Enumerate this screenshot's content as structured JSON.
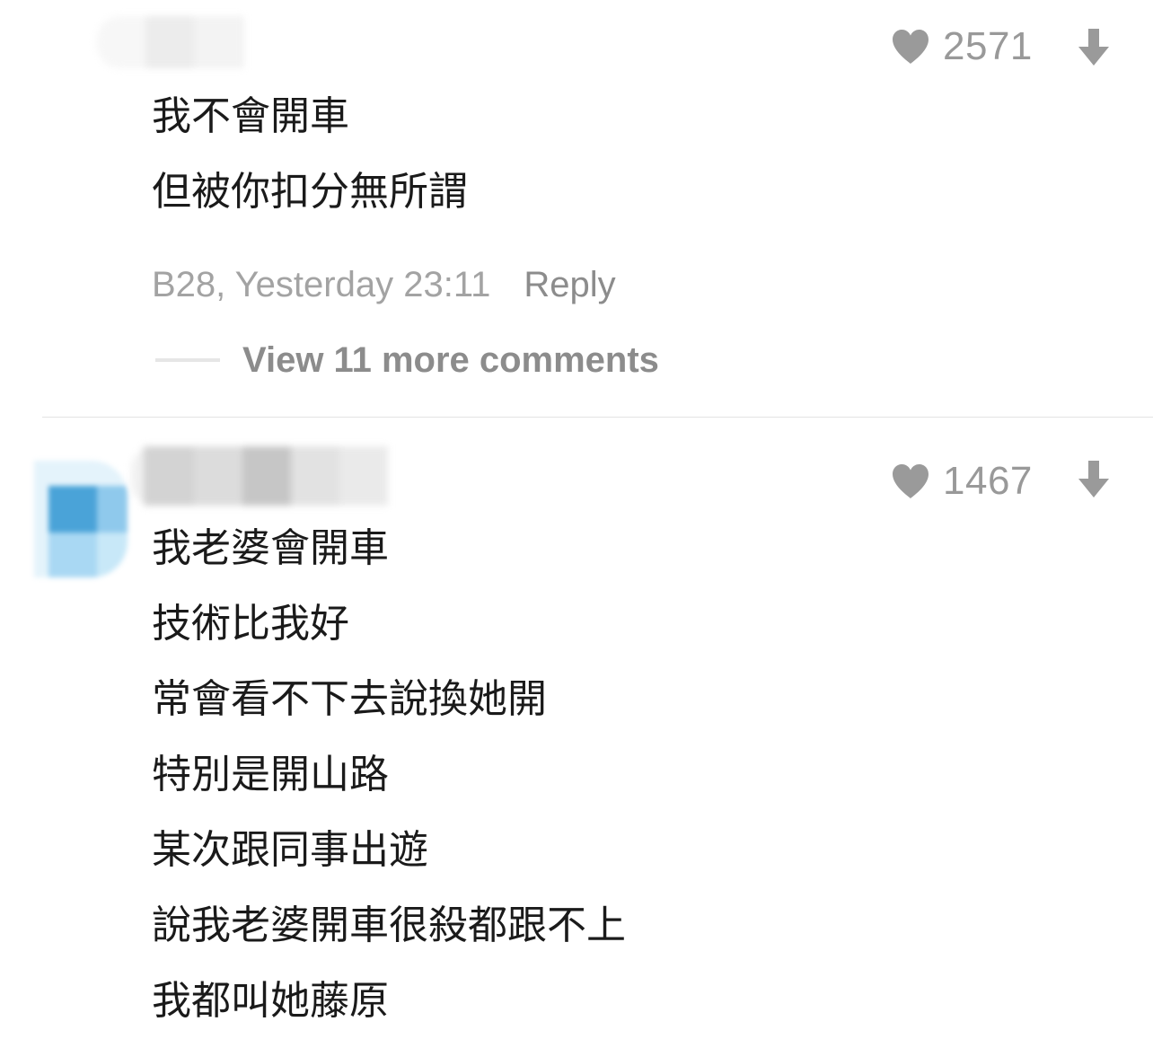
{
  "comments": [
    {
      "likes": "2571",
      "body": [
        "我不會開車",
        "但被你扣分無所謂"
      ],
      "meta": "B28, Yesterday 23:11",
      "reply_label": "Reply",
      "view_more": "View 11 more comments"
    },
    {
      "likes": "1467",
      "body": [
        "我老婆會開車",
        "技術比我好",
        "常會看不下去說換她開",
        "特別是開山路",
        "某次跟同事出遊",
        "說我老婆開車很殺都跟不上",
        "我都叫她藤原"
      ]
    }
  ],
  "icons": {
    "like": "heart-icon",
    "downvote": "arrow-down-icon"
  },
  "colors": {
    "count_gray": "#999999",
    "icon_gray": "#9a9a9a",
    "meta_gray": "#a3a3a3",
    "reply_gray": "#8c8c8c",
    "avatar_blue": "#4aa3d8"
  }
}
